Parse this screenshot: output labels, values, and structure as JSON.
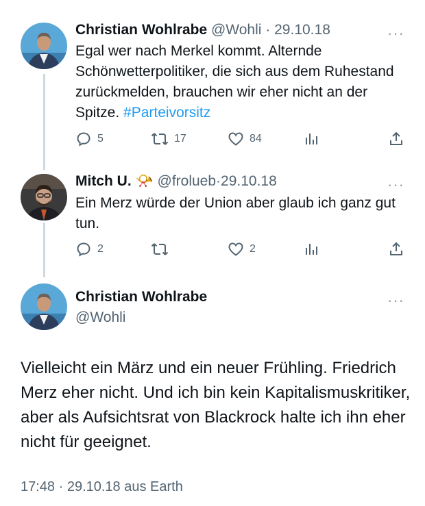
{
  "tweets": [
    {
      "name": "Christian Wohlrabe",
      "handle": "@Wohli",
      "separator": "·",
      "date": "29.10.18",
      "more": "···",
      "text": "Egal wer nach Merkel kommt. Alternde Schönwetterpolitiker, die sich aus dem Ruhestand zurückmelden, brauchen wir eher nicht an der Spitze. ",
      "hashtag": "#Parteivorsitz",
      "replies": "5",
      "retweets": "17",
      "likes": "84"
    },
    {
      "name": "Mitch U.",
      "emoji": "📯",
      "handle": "@frolueb",
      "separator": "·",
      "date": "29.10.18",
      "more": "···",
      "text": "Ein Merz würde der Union aber glaub ich ganz gut tun.",
      "replies": "2",
      "retweets": "",
      "likes": "2"
    }
  ],
  "main": {
    "name": "Christian Wohlrabe",
    "handle": "@Wohli",
    "more": "···",
    "text": "Vielleicht ein März und ein neuer Frühling. Friedrich Merz eher nicht. Und ich bin kein Kapitalismuskritiker, aber als Aufsichtsrat von Blackrock halte ich ihn eher nicht für geeignet.",
    "meta": "17:48 · 29.10.18 aus Earth"
  },
  "colors": {
    "accent": "#1d9bf0",
    "secondary_text": "#536471",
    "thread_line": "#cfd9de"
  }
}
